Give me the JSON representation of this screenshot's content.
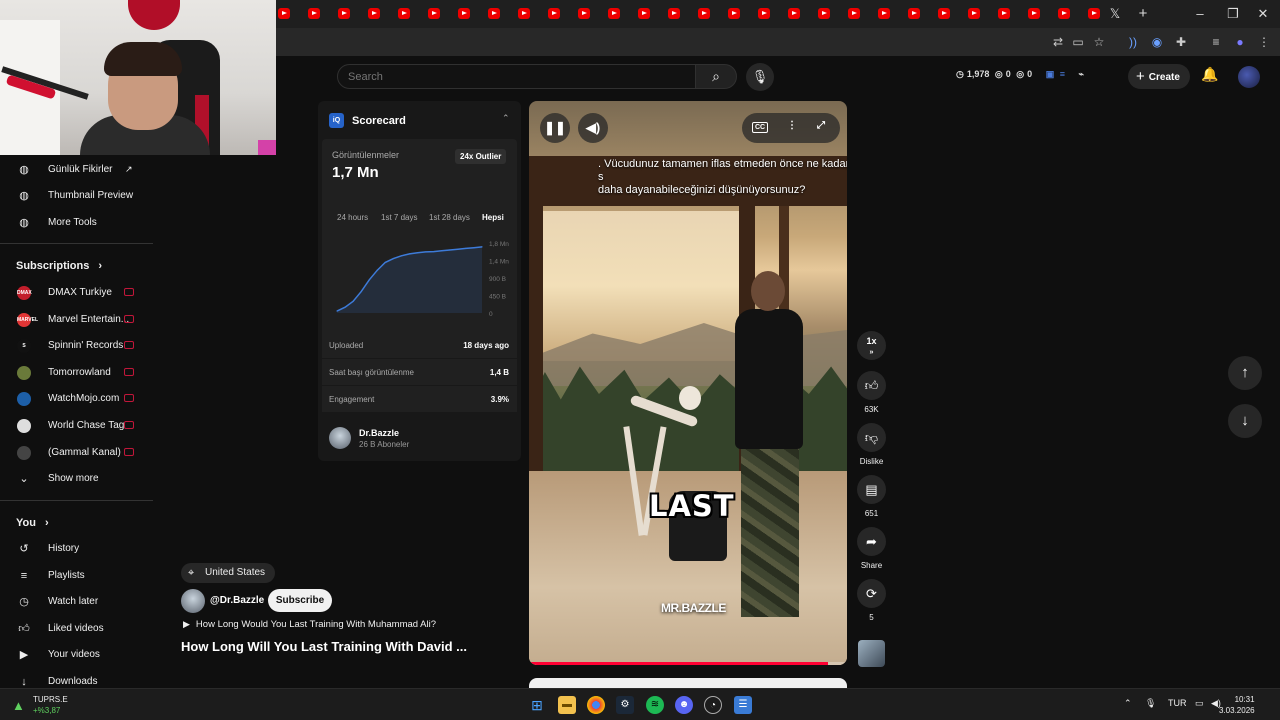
{
  "browser": {
    "tab_count": 28,
    "window_controls": [
      "x-icon",
      "new-tab-icon",
      "minimize-icon",
      "restore-icon",
      "close-icon"
    ]
  },
  "search": {
    "placeholder": "Search"
  },
  "header": {
    "stat_views": "1,978",
    "stat_b": "0",
    "stat_c": "0",
    "create_label": "Create"
  },
  "sidebar": {
    "tools": [
      {
        "label": "Günlük Fikirler",
        "icon": "external-link-icon"
      },
      {
        "label": "Thumbnail Preview"
      },
      {
        "label": "More Tools"
      }
    ],
    "subscriptions_title": "Subscriptions",
    "subscriptions": [
      {
        "label": "DMAX Turkiye",
        "badge": "DMAX",
        "color": "#c21e2b"
      },
      {
        "label": "Marvel Entertain...",
        "badge": "MARVEL",
        "color": "#e23636"
      },
      {
        "label": "Spinnin' Records",
        "badge": "S",
        "color": "#111111"
      },
      {
        "label": "Tomorrowland",
        "badge": "",
        "color": "#6a7a3a"
      },
      {
        "label": "WatchMojo.com",
        "badge": "",
        "color": "#1d5fa8"
      },
      {
        "label": "World Chase Tag",
        "badge": "",
        "color": "#dedede"
      },
      {
        "label": "(Gammal Kanal)",
        "badge": "",
        "color": "#444444"
      }
    ],
    "show_more": "Show more",
    "you_title": "You",
    "you_items": [
      {
        "label": "History",
        "icon": "history-icon"
      },
      {
        "label": "Playlists",
        "icon": "playlists-icon"
      },
      {
        "label": "Watch later",
        "icon": "clock-icon"
      },
      {
        "label": "Liked videos",
        "icon": "thumbs-up-icon"
      },
      {
        "label": "Your videos",
        "icon": "video-icon"
      },
      {
        "label": "Downloads",
        "icon": "download-icon"
      }
    ]
  },
  "scorecard": {
    "logo": "iQ",
    "title": "Scorecard",
    "views_label": "Görüntülenmeler",
    "views_value": "1,7 Mn",
    "outlier_badge": "24x Outlier",
    "tabs": [
      "24 hours",
      "1st 7 days",
      "1st 28 days",
      "Hepsi"
    ],
    "active_tab": "Hepsi",
    "rows": [
      {
        "label": "Uploaded",
        "value": "18 days ago"
      },
      {
        "label": "Saat başı görüntülenme",
        "value": "1,4 B"
      },
      {
        "label": "Engagement",
        "value": "3.9%"
      }
    ],
    "channel_name": "Dr.Bazzle",
    "channel_subs": "26 B Aboneler"
  },
  "chart_data": {
    "type": "area",
    "title": "",
    "x": [
      0,
      1,
      2,
      3,
      4,
      5,
      6,
      7,
      8,
      9,
      10,
      11,
      12,
      13,
      14,
      15,
      16,
      17,
      18
    ],
    "values": [
      0.05,
      0.15,
      0.3,
      0.55,
      0.85,
      1.1,
      1.3,
      1.4,
      1.47,
      1.52,
      1.55,
      1.57,
      1.58,
      1.6,
      1.62,
      1.64,
      1.66,
      1.68,
      1.7
    ],
    "y_ticks": [
      "1,8 Mn",
      "1,4 Mn",
      "900 B",
      "450 B",
      "0"
    ],
    "ylim": [
      0,
      1.8
    ],
    "color": "#3d7bd9",
    "grid": false
  },
  "video": {
    "caption": ". Vücudunuz tamamen iflas etmeden önce ne kadar s\ndaha dayanabileceğinizi düşünüyorsunuz?",
    "overlay_text": "LAST",
    "watermark": "MR.BAZZLE",
    "cc_label": "CC",
    "progress": 0.94
  },
  "actions": {
    "speed": "1x",
    "likes": "63K",
    "dislike": "Dislike",
    "comments": "651",
    "share": "Share",
    "remix": "5"
  },
  "info": {
    "location": "United States",
    "channel_handle": "@Dr.Bazzle",
    "subscribe": "Subscribe",
    "related": "How Long Would You Last Training With Muhammad Ali?",
    "title": "How Long Will You Last Training With David ..."
  },
  "taskbar": {
    "stock_name": "TUPRS.E",
    "stock_change": "+%3,87",
    "lang": "TUR",
    "time": "10:31",
    "date": "3.03.2026"
  }
}
